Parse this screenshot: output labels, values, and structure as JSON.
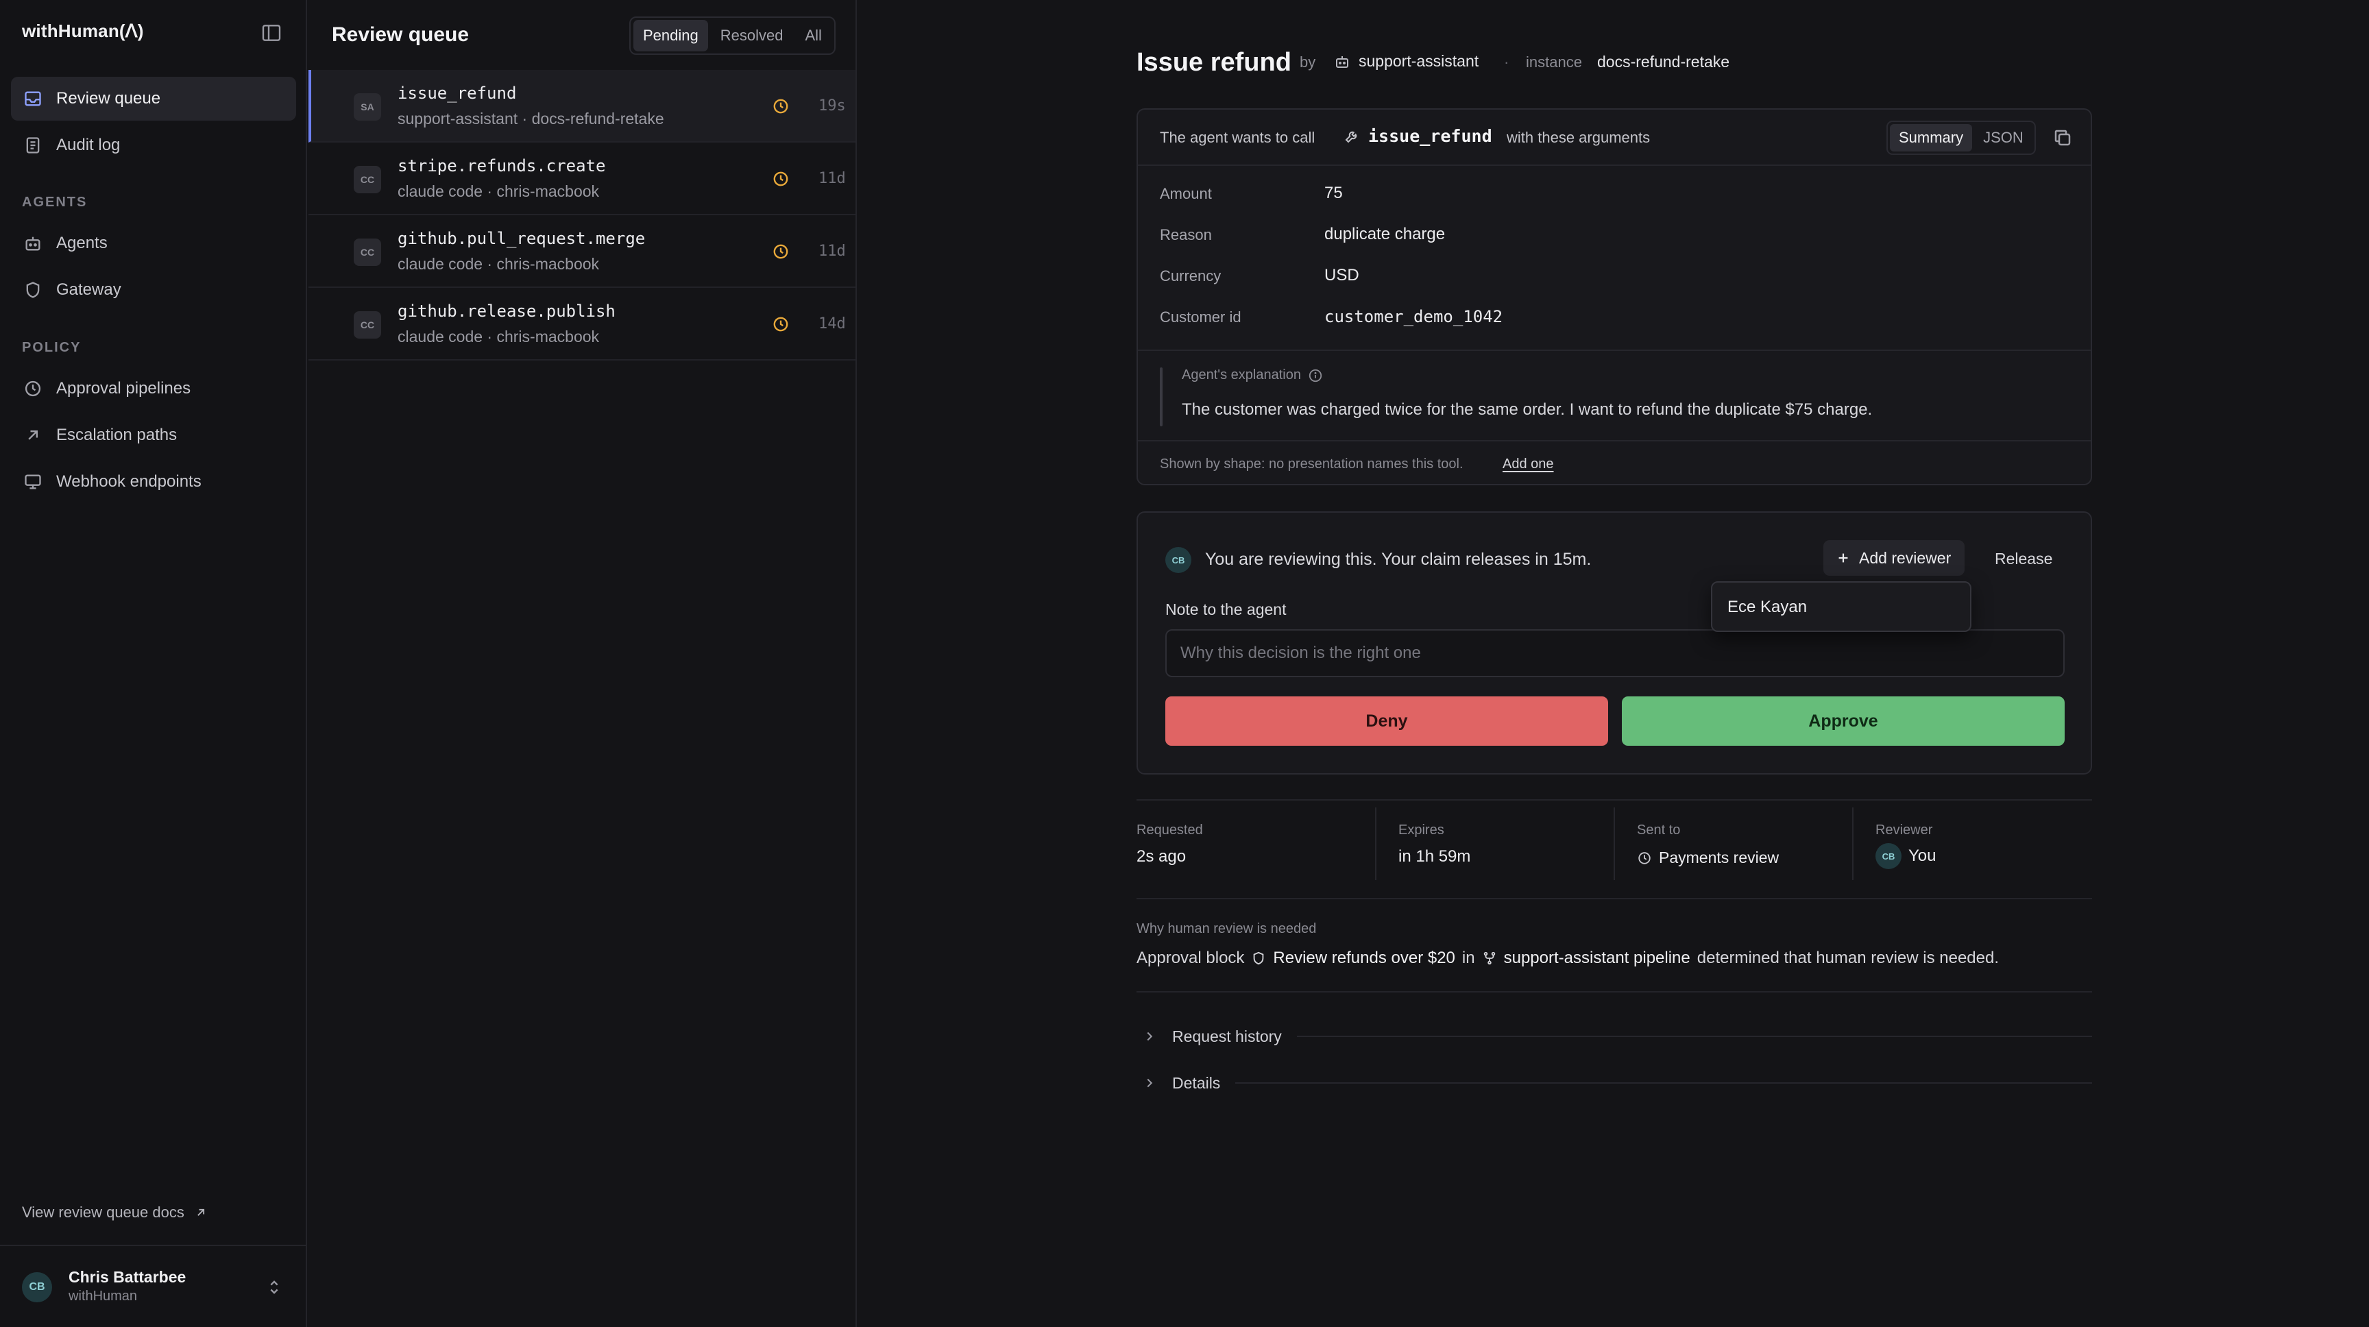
{
  "app": {
    "brand": "withHuman(ᐱ)",
    "colors": {
      "accent": "#6d7ff0",
      "deny": "#e06464",
      "approve": "#66bd7a",
      "pending_clock": "#e9a93a"
    }
  },
  "sidebar": {
    "items": [
      {
        "label": "Review queue",
        "icon": "inbox-icon",
        "active": true
      },
      {
        "label": "Audit log",
        "icon": "document-icon",
        "active": false
      }
    ],
    "agents_section": "AGENTS",
    "agents_items": [
      {
        "label": "Agents",
        "icon": "robot-icon"
      },
      {
        "label": "Gateway",
        "icon": "shield-icon"
      }
    ],
    "policy_section": "POLICY",
    "policy_items": [
      {
        "label": "Approval pipelines",
        "icon": "clock-icon"
      },
      {
        "label": "Escalation paths",
        "icon": "arrow-up-right-icon"
      },
      {
        "label": "Webhook endpoints",
        "icon": "monitor-icon"
      }
    ],
    "docs_link": "View review queue docs",
    "user": {
      "initials": "CB",
      "name": "Chris Battarbee",
      "org": "withHuman"
    }
  },
  "queue": {
    "title": "Review queue",
    "filters": [
      "Pending",
      "Resolved",
      "All"
    ],
    "active_filter": "Pending",
    "items": [
      {
        "badge": "SA",
        "name": "issue_refund",
        "sub": "support-assistant · docs-refund-retake",
        "time": "19s",
        "selected": true
      },
      {
        "badge": "CC",
        "name": "stripe.refunds.create",
        "sub": "claude code · chris-macbook",
        "time": "11d",
        "selected": false
      },
      {
        "badge": "CC",
        "name": "github.pull_request.merge",
        "sub": "claude code · chris-macbook",
        "time": "11d",
        "selected": false
      },
      {
        "badge": "CC",
        "name": "github.release.publish",
        "sub": "claude code · chris-macbook",
        "time": "14d",
        "selected": false
      }
    ]
  },
  "detail": {
    "title": "Issue refund",
    "by_label": "by",
    "agent": "support-assistant",
    "dot": "·",
    "instance_label": "instance",
    "instance": "docs-refund-retake",
    "call": {
      "intro": "The agent wants to call",
      "tool": "issue_refund",
      "with": "with these arguments",
      "view_tabs": [
        "Summary",
        "JSON"
      ],
      "active_view": "Summary",
      "arguments": [
        {
          "label": "Amount",
          "value": "75",
          "mono": false
        },
        {
          "label": "Reason",
          "value": "duplicate charge",
          "mono": false
        },
        {
          "label": "Currency",
          "value": "USD",
          "mono": false
        },
        {
          "label": "Customer id",
          "value": "customer_demo_1042",
          "mono": true
        }
      ],
      "explanation_label": "Agent's explanation",
      "explanation": "The customer was charged twice for the same order. I want to refund the duplicate $75 charge.",
      "shape_note": "Shown by shape: no presentation names this tool.",
      "shape_link": "Add one"
    },
    "review": {
      "avatar": "CB",
      "status": "You are reviewing this. Your claim releases in 15m.",
      "add_reviewer": "Add reviewer",
      "release": "Release",
      "reviewer_option": "Ece Kayan",
      "note_label": "Note to the agent",
      "note_placeholder": "Why this decision is the right one",
      "note_value": "",
      "deny": "Deny",
      "approve": "Approve"
    },
    "meta": {
      "requested_label": "Requested",
      "requested": "2s ago",
      "expires_label": "Expires",
      "expires": "in 1h 59m",
      "sent_to_label": "Sent to",
      "sent_to": "Payments review",
      "reviewer_label": "Reviewer",
      "reviewer_avatar": "CB",
      "reviewer": "You"
    },
    "why": {
      "label": "Why human review is needed",
      "prefix": "Approval block",
      "block": "Review refunds over $20",
      "in": "in",
      "pipeline": "support-assistant pipeline",
      "suffix": "determined that human review is needed."
    },
    "sections": [
      "Request history",
      "Details"
    ]
  }
}
